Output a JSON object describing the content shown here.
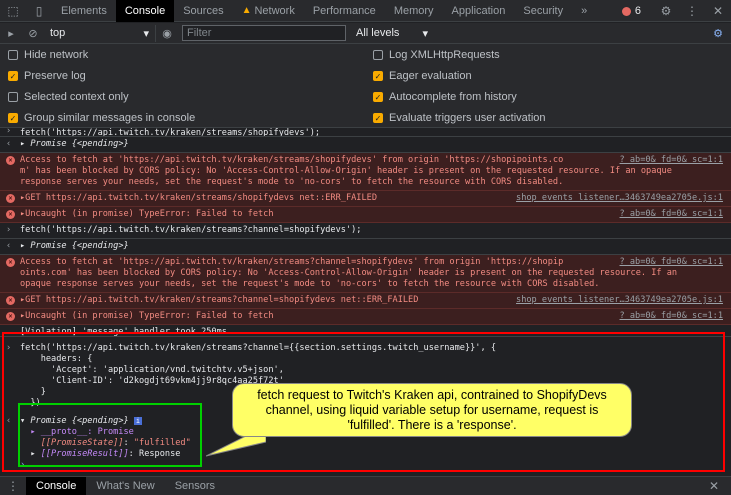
{
  "toolbar": {
    "tabs": [
      "Elements",
      "Console",
      "Sources",
      "Network",
      "Performance",
      "Memory",
      "Application",
      "Security"
    ],
    "more": "»",
    "error_count": "6"
  },
  "filterbar": {
    "context": "top",
    "filter_placeholder": "Filter",
    "levels": "All levels"
  },
  "settings": {
    "hide_network": "Hide network",
    "preserve_log": "Preserve log",
    "selected_context_only": "Selected context only",
    "group_similar": "Group similar messages in console",
    "log_xhr": "Log XMLHttpRequests",
    "eager_eval": "Eager evaluation",
    "autocomplete": "Autocomplete from history",
    "eval_triggers": "Evaluate triggers user activation"
  },
  "log": {
    "r1": "fetch('https://api.twitch.tv/kraken/streams/shopifydevs');",
    "r2_prefix": "▸ Promise ",
    "r2_state": "{<pending>}",
    "r3a": "Access to fetch at 'https://api.twitch.tv/kraken/streams/shopifydevs' from origin 'https://shopipoints.co",
    "r3b": "m' has been blocked by CORS policy: No 'Access-Control-Allow-Origin' header is present on the requested resource. If an opaque",
    "r3c": "response serves your needs, set the request's mode to 'no-cors' to fetch the resource with CORS disabled.",
    "r3_src": "?_ab=0&_fd=0&_sc=1:1",
    "r4": "▸GET https://api.twitch.tv/kraken/streams/shopifydevs net::ERR_FAILED",
    "r4_src": "shop_events_listener…3463749ea2705e.js:1",
    "r5": "▸Uncaught (in promise) TypeError: Failed to fetch",
    "r5_src": "?_ab=0&_fd=0&_sc=1:1",
    "r6": "fetch('https://api.twitch.tv/kraken/streams?channel=shopifydevs');",
    "r7_prefix": "▸ Promise ",
    "r7_state": "{<pending>}",
    "r8a": "Access to fetch at 'https://api.twitch.tv/kraken/streams?channel=shopifydevs' from origin 'https://shopip",
    "r8b": "oints.com' has been blocked by CORS policy: No 'Access-Control-Allow-Origin' header is present on the requested resource. If an",
    "r8c": "opaque response serves your needs, set the request's mode to 'no-cors' to fetch the resource with CORS disabled.",
    "r8_src": "?_ab=0&_fd=0&_sc=1:1",
    "r9": "▸GET https://api.twitch.tv/kraken/streams?channel=shopifydevs net::ERR_FAILED",
    "r9_src": "shop_events_listener…3463749ea2705e.js:1",
    "r10": "▸Uncaught (in promise) TypeError: Failed to fetch",
    "r10_src": "?_ab=0&_fd=0&_sc=1:1",
    "r11": "[Violation] 'message' handler took 250ms",
    "code1": "fetch('https://api.twitch.tv/kraken/streams?channel={{section.settings.twitch_username}}', {",
    "code2": "    headers: {",
    "code3": "      'Accept': 'application/vnd.twitchtv.v5+json',",
    "code4": "      'Client-ID': 'd2kogdjt69vkm4jj9r8qc4aa25f72t'",
    "code5": "    }",
    "code6": "  })",
    "p1_prefix": "▾ Promise ",
    "p1_state": "{<pending>}",
    "p2": "  ▸ __proto__: Promise",
    "p3_key": "[[PromiseState]]",
    "p3_val": "\"fulfilled\"",
    "p4_key": "[[PromiseResult]]",
    "p4_val": "Response"
  },
  "callout": "fetch request to Twitch's Kraken api, contrained to ShopifyDevs channel, using liquid variable setup for username, request is 'fulfilled'. There is a 'response'.",
  "drawer": {
    "tabs": [
      "Console",
      "What's New",
      "Sensors"
    ]
  }
}
